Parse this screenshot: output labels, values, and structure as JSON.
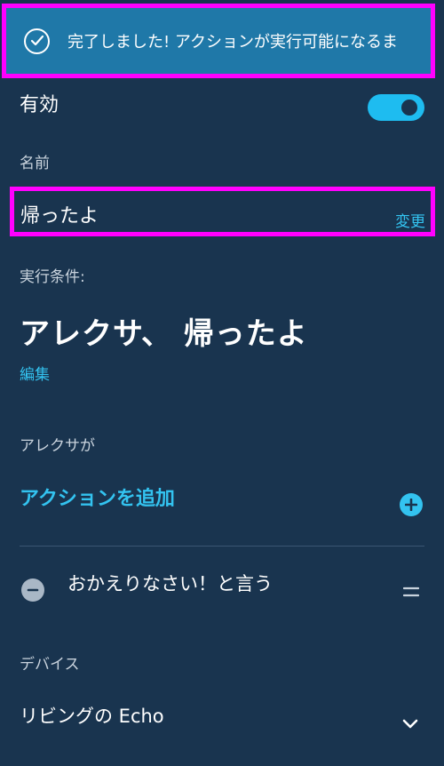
{
  "toast": {
    "message": "完了しました! アクションが実行可能になるま",
    "icon": "check-circle-icon"
  },
  "enabled": {
    "label": "有効",
    "toggle_on": true
  },
  "name_section": {
    "caption": "名前",
    "value": "帰ったよ",
    "change_label": "変更"
  },
  "trigger_section": {
    "caption": "実行条件:",
    "phrase": "アレクサ、 帰ったよ",
    "edit_label": "編集"
  },
  "actions_section": {
    "caption": "アレクサが",
    "add_label": "アクションを追加",
    "add_icon": "plus-circle-icon"
  },
  "action_item": {
    "text": "おかえりなさい！と言う",
    "remove_icon": "minus-circle-icon",
    "drag_icon": "drag-handle-icon"
  },
  "device_section": {
    "caption": "デバイス",
    "value": "リビングの Echo",
    "icon": "chevron-down-icon"
  },
  "colors": {
    "background": "#19344f",
    "accent": "#33c3f0",
    "toast": "#1f78a8",
    "highlight": "#ff00ff"
  }
}
